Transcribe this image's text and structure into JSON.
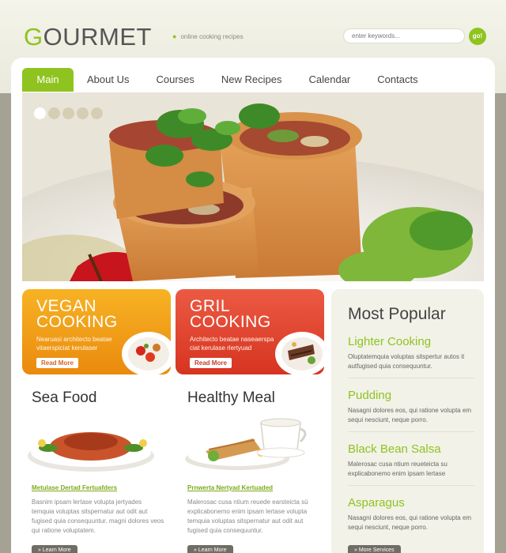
{
  "header": {
    "logo_first": "G",
    "logo_rest": "OURMET",
    "tagline": "online cooking recipes",
    "search_placeholder": "enter keywords...",
    "go_label": "go!"
  },
  "nav": {
    "items": [
      "Main",
      "About Us",
      "Courses",
      "New Recipes",
      "Calendar",
      "Contacts"
    ],
    "active_index": 0
  },
  "slider": {
    "dot_count": 5,
    "active_index": 0
  },
  "promos": [
    {
      "title_line1": "VEGAN",
      "title_line2": "COOKING",
      "description": "Nearuasi architecto beatae vitaerspiciat kerulaser",
      "button": "Read More"
    },
    {
      "title_line1": "GRIL",
      "title_line2": "COOKING",
      "description": "Architecto beatae naseaerspa ciat kerulase rlertyuad",
      "button": "Read More"
    }
  ],
  "articles": [
    {
      "title": "Sea Food",
      "link": "Metulase Dertad Fertuafders",
      "text": "Basnim ipsam lertase volupta jertyades temquia voluptas sitspernatur aut odit aut fugised quia consequuntur. magni dolores veos qui ratione voluptatem.",
      "button": "» Learn More"
    },
    {
      "title": "Healthy Meal",
      "link": "Prnwerta Nertyad Kertuaded",
      "text": "Malerosac cusa ntium reuede earsteicta sü explicabonemo enim ipsam lertase volupta temquia voluptas sitspernatur aut odit aut fugised quia consequuntur.",
      "button": "» Learn More"
    }
  ],
  "sidebar": {
    "title": "Most Popular",
    "items": [
      {
        "title": "Lighter Cooking",
        "text": "Oluptatemquia voluptas sitspertur autos it autfugised quia consequuntur."
      },
      {
        "title": "Pudding",
        "text": "Nasagni dolores eos, qui ratione volupta em sequi nesciunt, neque porro."
      },
      {
        "title": "Black Bean Salsa",
        "text": "Malerosac cusa ntium reueteicta su explicabonemo enim ipsam lertase"
      },
      {
        "title": "Asparagus",
        "text": "Nasagni dolores eos, qui ratione volupta em sequi nesciunt, neque porro."
      }
    ],
    "button": "» More Services"
  },
  "colors": {
    "accent_green": "#8fc31f",
    "vegan_orange": "#f2a31a",
    "grill_red": "#e04a33",
    "backdrop": "#a5a293"
  }
}
